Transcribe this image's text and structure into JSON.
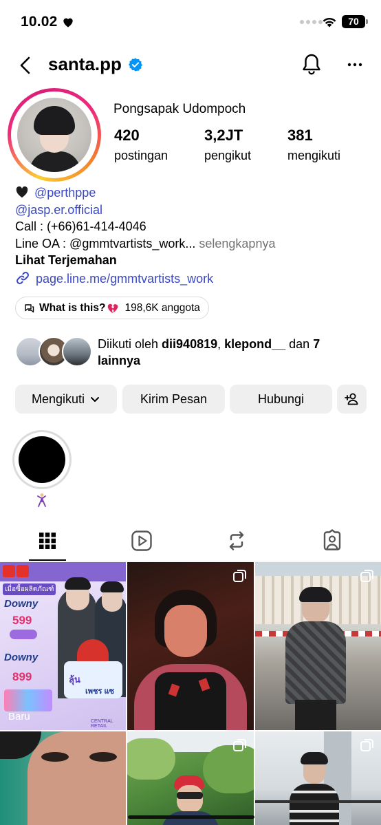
{
  "status_bar": {
    "time": "10.02",
    "battery": "70"
  },
  "header": {
    "username": "santa.pp"
  },
  "profile": {
    "full_name": "Pongsapak Udompoch",
    "stats": [
      {
        "value": "420",
        "label": "postingan"
      },
      {
        "value": "3,2JT",
        "label": "pengikut"
      },
      {
        "value": "381",
        "label": "mengikuti"
      }
    ]
  },
  "bio": {
    "mention_1": "@perthppe",
    "mention_2": "@jasp.er.official",
    "line_call": "Call : (+66)61-414-4046",
    "line_oa": "Line OA : @gmmtvartists_work...",
    "more": "selengkapnya",
    "translate": "Lihat Terjemahan",
    "link": "page.line.me/gmmtvartists_work"
  },
  "channel": {
    "name": "What is this?",
    "members": "198,6K anggota"
  },
  "followed_by": {
    "prefix": "Diikuti oleh ",
    "user_1": "dii940819",
    "sep": ", ",
    "user_2": "klepond__",
    "mid": " dan ",
    "others": "7 lainnya"
  },
  "buttons": {
    "following": "Mengikuti",
    "message": "Kirim Pesan",
    "contact": "Hubungi"
  },
  "grid": {
    "new_label": "Baru",
    "promo": {
      "top_text": "เมื่อซื้อผลิตภัณฑ์",
      "brand": "Downy",
      "price_1": "599",
      "price_2": "899",
      "prize": "ลุ้น",
      "badge": "เพชร แซ",
      "store": "CENTRAL RETAIL"
    }
  },
  "colors": {
    "link": "#3b48c4",
    "button_bg": "#efefef",
    "verified": "#0095f6"
  }
}
